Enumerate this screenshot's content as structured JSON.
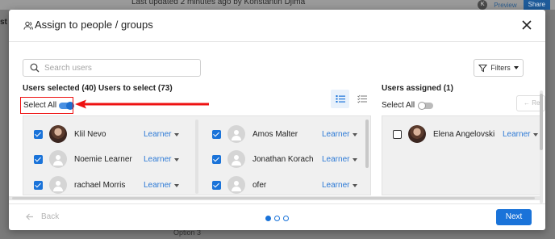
{
  "background": {
    "left_text": "st",
    "updated_text": "Last updated 2 minutes ago by Konstantin Djima",
    "avatar_initial": "K",
    "preview_label": "Preview",
    "share_label": "Share",
    "bottom_text": "Option 3"
  },
  "modal": {
    "title": "Assign to people / groups",
    "search": {
      "placeholder": "Search users",
      "value": ""
    },
    "filters_label": "Filters",
    "users_selected_heading": "Users selected (40) Users to select (73)",
    "select_all_label": "Select All",
    "select_all_on": true,
    "users_assigned_heading": "Users assigned (1)",
    "assigned_select_all_label": "Select All",
    "assigned_select_all_on": false,
    "right_action_label": "Re",
    "left_users": [
      {
        "name": "Klil Nevo",
        "role": "Learner",
        "checked": true,
        "avatar": "photo"
      },
      {
        "name": "Noemie Learner",
        "role": "Learner",
        "checked": true,
        "avatar": "placeholder"
      },
      {
        "name": "rachael Morris",
        "role": "Learner",
        "checked": true,
        "avatar": "placeholder"
      }
    ],
    "mid_users": [
      {
        "name": "Amos Malter",
        "role": "Learner",
        "checked": true,
        "avatar": "placeholder"
      },
      {
        "name": "Jonathan Korach",
        "role": "Learner",
        "checked": true,
        "avatar": "placeholder"
      },
      {
        "name": "ofer",
        "role": "Learner",
        "checked": true,
        "avatar": "placeholder"
      }
    ],
    "assigned_users": [
      {
        "name": "Elena Angelovski",
        "role": "Learner",
        "checked": false,
        "avatar": "photo"
      }
    ],
    "footer": {
      "back_label": "Back",
      "next_label": "Next",
      "steps_total": 3,
      "current_step": 1
    },
    "colors": {
      "accent": "#1a73d9",
      "role_link": "#2d7ad6",
      "annotation": "#e11111"
    },
    "icons": [
      "people-icon",
      "close-icon",
      "search-icon",
      "filter-icon",
      "list-view-icon",
      "checklist-view-icon",
      "arrow-left-icon",
      "chevron-down-icon"
    ]
  }
}
